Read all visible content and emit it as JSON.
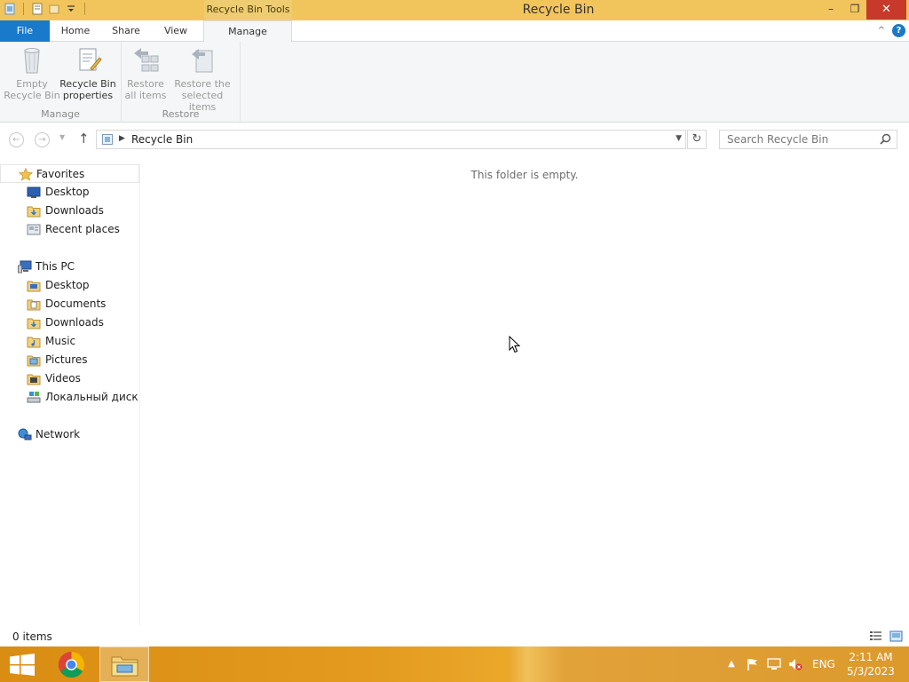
{
  "window": {
    "title": "Recycle Bin",
    "context_tab_label": "Recycle Bin Tools",
    "minimize_glyph": "–",
    "restore_glyph": "❐",
    "close_glyph": "✕"
  },
  "ribbon": {
    "tabs": [
      {
        "label": "File"
      },
      {
        "label": "Home"
      },
      {
        "label": "Share"
      },
      {
        "label": "View"
      },
      {
        "label": "Manage"
      }
    ],
    "groups": {
      "manage": {
        "label": "Manage",
        "buttons": [
          {
            "label_line1": "Empty",
            "label_line2": "Recycle Bin",
            "icon": "empty-recycle-bin-icon",
            "enabled": false
          },
          {
            "label_line1": "Recycle Bin",
            "label_line2": "properties",
            "icon": "properties-icon",
            "enabled": true
          }
        ]
      },
      "restore": {
        "label": "Restore",
        "buttons": [
          {
            "label_line1": "Restore",
            "label_line2": "all items",
            "icon": "restore-all-icon",
            "enabled": false
          },
          {
            "label_line1": "Restore the",
            "label_line2": "selected items",
            "icon": "restore-selected-icon",
            "enabled": false
          }
        ]
      }
    },
    "help_glyph": "?",
    "collapse_glyph": "^"
  },
  "address": {
    "path": "Recycle Bin",
    "search_placeholder": "Search Recycle Bin",
    "up_glyph": "↑",
    "refresh_glyph": "↻"
  },
  "navpane": {
    "favorites": {
      "label": "Favorites",
      "items": [
        {
          "label": "Desktop",
          "icon": "desktop-icon"
        },
        {
          "label": "Downloads",
          "icon": "downloads-folder-icon"
        },
        {
          "label": "Recent places",
          "icon": "recent-places-icon"
        }
      ]
    },
    "this_pc": {
      "label": "This PC",
      "items": [
        {
          "label": "Desktop",
          "icon": "folder-icon"
        },
        {
          "label": "Documents",
          "icon": "documents-folder-icon"
        },
        {
          "label": "Downloads",
          "icon": "downloads-folder-icon"
        },
        {
          "label": "Music",
          "icon": "music-folder-icon"
        },
        {
          "label": "Pictures",
          "icon": "pictures-folder-icon"
        },
        {
          "label": "Videos",
          "icon": "videos-folder-icon"
        },
        {
          "label": "Локальный диск (C",
          "icon": "local-disk-icon"
        }
      ]
    },
    "network": {
      "label": "Network"
    }
  },
  "content": {
    "empty_message": "This folder is empty."
  },
  "statusbar": {
    "item_count": "0 items"
  },
  "taskbar": {
    "apps": [
      {
        "name": "Google Chrome",
        "icon": "chrome-icon"
      },
      {
        "name": "File Explorer",
        "icon": "file-explorer-icon"
      }
    ],
    "language": "ENG",
    "time": "2:11 AM",
    "date": "5/3/2023"
  },
  "colors": {
    "title_bar": "#f2c55c",
    "file_tab": "#1979ca",
    "taskbar": "#e39a1e",
    "close_button": "#c7392b"
  }
}
